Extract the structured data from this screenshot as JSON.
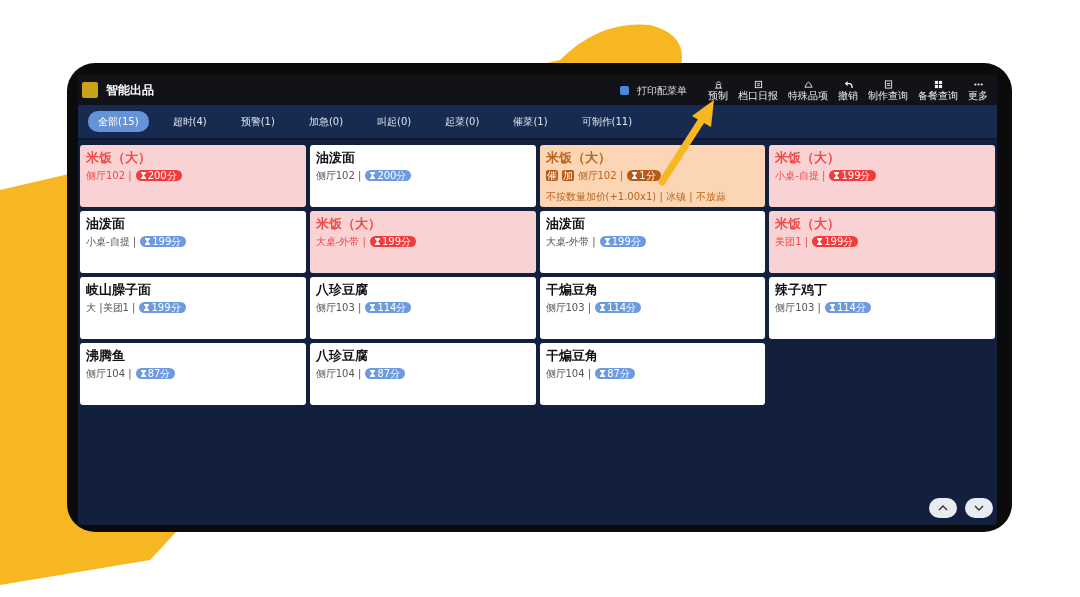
{
  "app": {
    "title": "智能出品"
  },
  "print_option": {
    "label": "打印配菜单",
    "checked": true
  },
  "toolbar": [
    {
      "label": "预制",
      "kind": "prep"
    },
    {
      "label": "档口日报",
      "kind": "report"
    },
    {
      "label": "特殊品项",
      "kind": "special"
    },
    {
      "label": "撤销",
      "kind": "undo"
    },
    {
      "label": "制作查询",
      "kind": "query"
    },
    {
      "label": "备餐查询",
      "kind": "grid"
    },
    {
      "label": "更多",
      "kind": "more"
    }
  ],
  "tabs": [
    {
      "label": "全部(15)",
      "selected": true
    },
    {
      "label": "超时(4)",
      "selected": false
    },
    {
      "label": "预警(1)",
      "selected": false
    },
    {
      "label": "加急(0)",
      "selected": false
    },
    {
      "label": "叫起(0)",
      "selected": false
    },
    {
      "label": "起菜(0)",
      "selected": false
    },
    {
      "label": "催菜(1)",
      "selected": false
    },
    {
      "label": "可制作(11)",
      "selected": false
    }
  ],
  "orders": [
    {
      "dish": "米饭（大）",
      "kind": "overdue",
      "location": "侧厅102 |",
      "timer": "200分"
    },
    {
      "dish": "油泼面",
      "kind": "normal",
      "location": "侧厅102 |",
      "timer": "200分"
    },
    {
      "dish": "米饭（大）",
      "kind": "urgent",
      "tags": [
        "催",
        "加"
      ],
      "location": "侧厅102 |",
      "timer": "1分",
      "notes": "不按数量加价(+1.00x1) | 冰镇 | 不放蒜"
    },
    {
      "dish": "米饭（大）",
      "kind": "overdue",
      "location": "小桌-自提 |",
      "timer": "199分"
    },
    {
      "dish": "油泼面",
      "kind": "normal",
      "location": "小桌-自提 |",
      "timer": "199分"
    },
    {
      "dish": "米饭（大）",
      "kind": "overdue",
      "location": "大桌-外带 |",
      "timer": "199分"
    },
    {
      "dish": "油泼面",
      "kind": "normal",
      "location": "大桌-外带 |",
      "timer": "199分"
    },
    {
      "dish": "米饭（大）",
      "kind": "overdue",
      "location": "美团1 |",
      "timer": "199分"
    },
    {
      "dish": "岐山臊子面",
      "kind": "normal",
      "location": "大 |美团1 |",
      "timer": "199分"
    },
    {
      "dish": "八珍豆腐",
      "kind": "normal",
      "location": "侧厅103 |",
      "timer": "114分"
    },
    {
      "dish": "干煸豆角",
      "kind": "normal",
      "location": "侧厅103 |",
      "timer": "114分"
    },
    {
      "dish": "辣子鸡丁",
      "kind": "normal",
      "location": "侧厅103 |",
      "timer": "114分"
    },
    {
      "dish": "沸腾鱼",
      "kind": "normal",
      "location": "侧厅104 |",
      "timer": "87分"
    },
    {
      "dish": "八珍豆腐",
      "kind": "normal",
      "location": "侧厅104 |",
      "timer": "87分"
    },
    {
      "dish": "干煸豆角",
      "kind": "normal",
      "location": "侧厅104 |",
      "timer": "87分"
    }
  ]
}
